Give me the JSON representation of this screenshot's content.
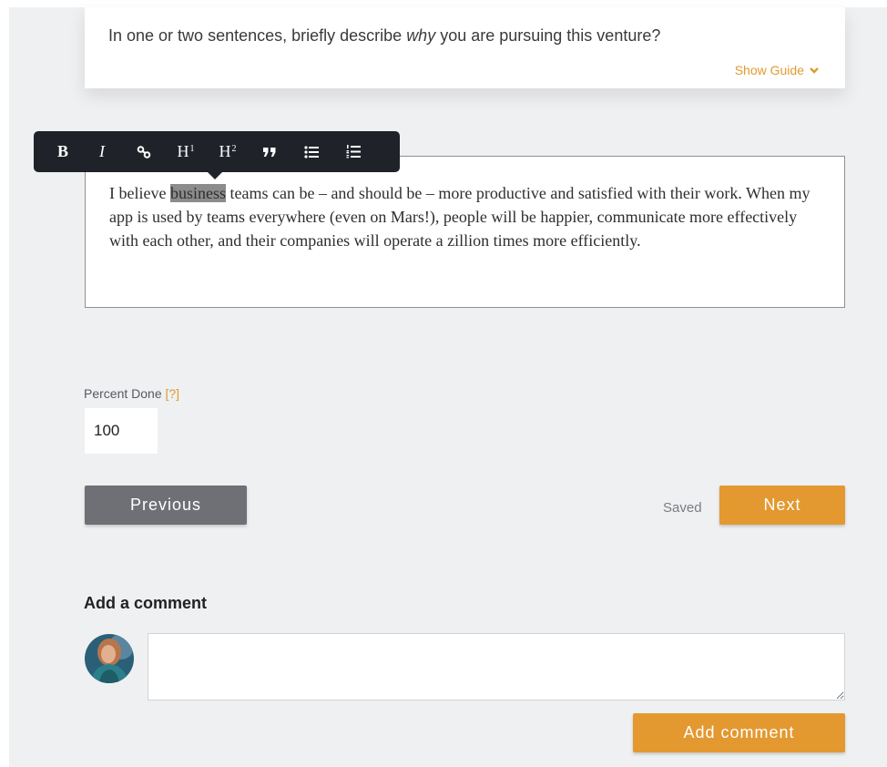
{
  "prompt": {
    "text_before": "In one or two sentences, briefly describe ",
    "text_em": "why",
    "text_after": " you are pursuing this venture?",
    "show_guide": "Show Guide"
  },
  "toolbar": {
    "bold": "B",
    "italic": "I",
    "h1": "H",
    "h1_sup": "1",
    "h2": "H",
    "h2_sup": "2",
    "icons": [
      "link-icon",
      "quote-icon",
      "bulleted-list-icon",
      "numbered-list-icon"
    ]
  },
  "editor": {
    "before": "I believe ",
    "selected": "business",
    "after": " teams can be – and should be – more productive and satisfied with their work. When my app is used by teams everywhere (even on Mars!), people will be happier, communicate more effectively with each other, and their companies will operate a zillion times more efficiently."
  },
  "percent_done": {
    "label": "Percent Done ",
    "help": "[?]",
    "value": "100"
  },
  "nav": {
    "previous": "Previous",
    "saved": "Saved",
    "next": "Next"
  },
  "comments": {
    "title": "Add a comment",
    "add_button": "Add comment"
  },
  "colors": {
    "accent": "#e3992f",
    "background": "#eff0f2",
    "toolbar": "#1f2329",
    "prev_button": "#6f7075"
  }
}
